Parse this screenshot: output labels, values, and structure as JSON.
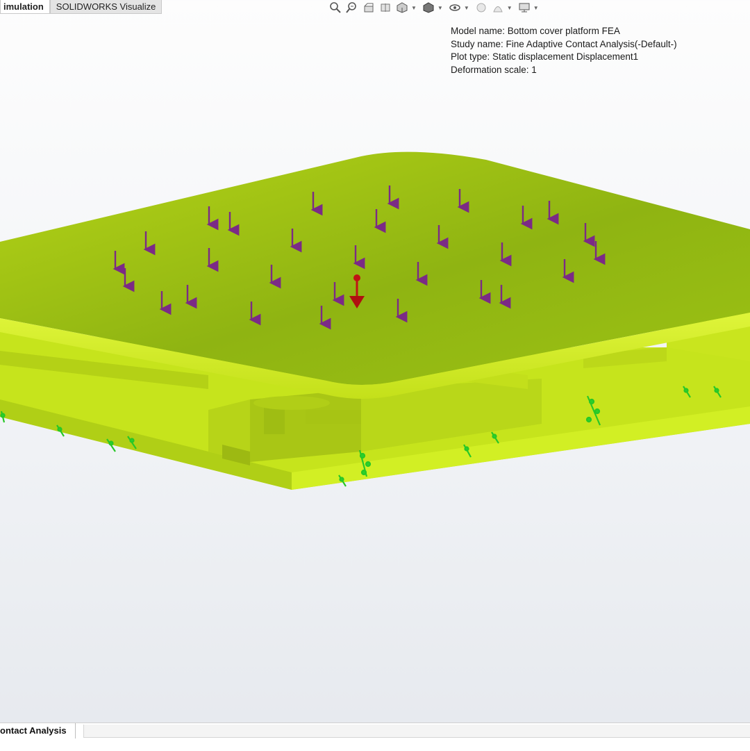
{
  "tabs": [
    {
      "label": "imulation",
      "active": true
    },
    {
      "label": "SOLIDWORKS Visualize",
      "active": false
    }
  ],
  "toolbar": {
    "icons": [
      "zoom-to-fit-icon",
      "zoom-to-area-icon",
      "previous-view-icon",
      "section-view-icon",
      "view-orientation-icon",
      "display-style-icon",
      "hide-show-items-icon",
      "edit-appearance-icon",
      "apply-scene-icon",
      "view-settings-icon"
    ]
  },
  "info": {
    "model": "Model name: Bottom cover platform FEA",
    "study": "Study name: Fine Adaptive Contact Analysis(-Default-)",
    "plot": "Plot type: Static displacement Displacement1",
    "scale": "Deformation scale: 1"
  },
  "bottom_tab": {
    "label": "ontact Analysis"
  },
  "colors": {
    "model_surface": "#a8cc14",
    "model_side": "#c8ea1a",
    "load_arrow": "#7b2a86",
    "remote_load": "#c01414",
    "fixture": "#2bd12b"
  }
}
